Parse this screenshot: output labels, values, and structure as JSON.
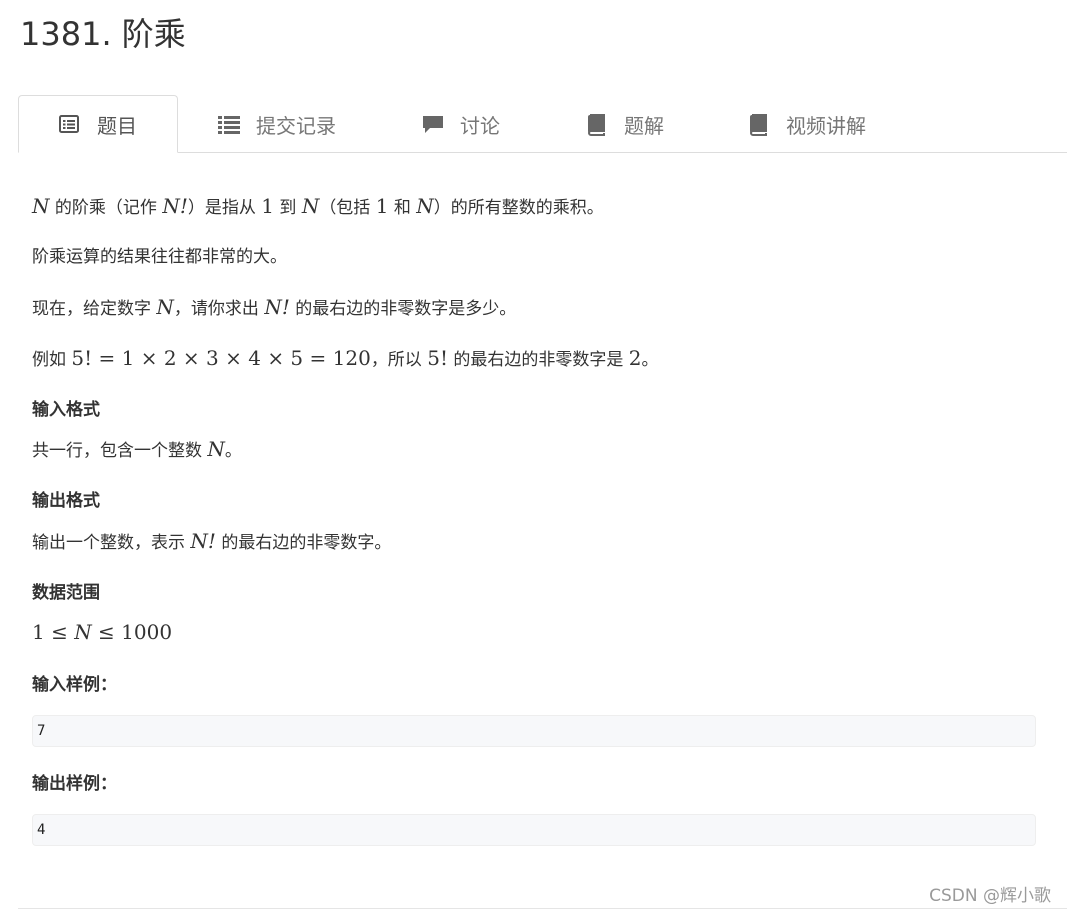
{
  "problem": {
    "title": "1381. 阶乘"
  },
  "tabs": [
    {
      "label": "题目",
      "icon": "list-alt-icon",
      "active": true
    },
    {
      "label": "提交记录",
      "icon": "list-icon",
      "active": false
    },
    {
      "label": "讨论",
      "icon": "comment-icon",
      "active": false
    },
    {
      "label": "题解",
      "icon": "book-icon",
      "active": false
    },
    {
      "label": "视频讲解",
      "icon": "book-icon",
      "active": false
    }
  ],
  "description": {
    "p1": {
      "var_n": "N",
      "t1": " 的阶乘（记作 ",
      "fact": "N!",
      "t2": "）是指从 ",
      "one": "1",
      "t3": " 到 ",
      "var_n2": "N",
      "t4": "（包括 ",
      "one2": "1",
      "t5": " 和 ",
      "var_n3": "N",
      "t6": "）的所有整数的乘积。"
    },
    "p2": "阶乘运算的结果往往都非常的大。",
    "p3": {
      "t1": "现在，给定数字 ",
      "var_n": "N",
      "t2": "，请你求出 ",
      "fact": "N!",
      "t3": " 的最右边的非零数字是多少。"
    },
    "p4": {
      "t1": "例如 ",
      "expr": "5! = 1 × 2 × 3 × 4 × 5 = 120",
      "t2": "，所以 ",
      "fact": "5!",
      "t3": " 的最右边的非零数字是 ",
      "digit": "2",
      "t4": "。"
    }
  },
  "input_format": {
    "heading": "输入格式",
    "t1": "共一行，包含一个整数 ",
    "var_n": "N",
    "t2": "。"
  },
  "output_format": {
    "heading": "输出格式",
    "t1": "输出一个整数，表示 ",
    "fact": "N!",
    "t2": " 的最右边的非零数字。"
  },
  "data_range": {
    "heading": "数据范围",
    "expr_a": "1 ≤ ",
    "var_n": "N",
    "expr_b": " ≤ 1000"
  },
  "sample_input": {
    "heading": "输入样例：",
    "value": "7"
  },
  "sample_output": {
    "heading": "输出样例：",
    "value": "4"
  },
  "watermark": "CSDN @辉小歌",
  "colors": {
    "text": "#333333",
    "tab_inactive": "#777777",
    "sample_bg": "#f7f8fa",
    "border": "#dddddd",
    "icon": "#555555"
  }
}
